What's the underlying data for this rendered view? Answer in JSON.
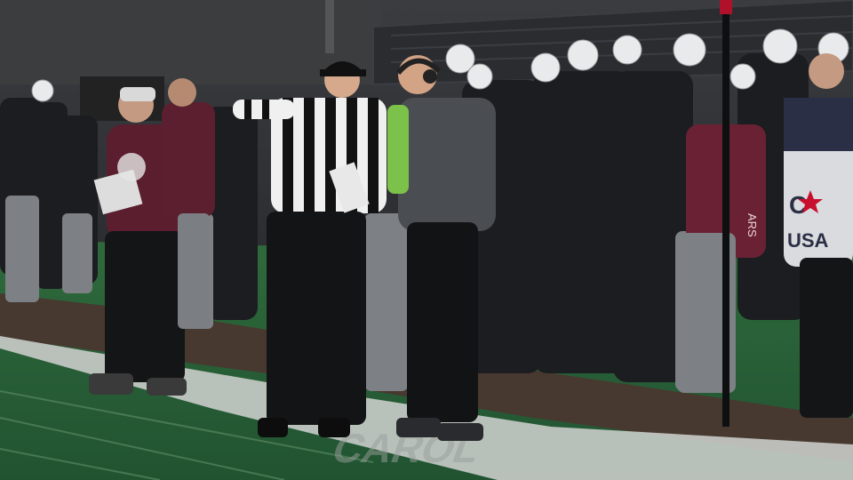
{
  "scene": {
    "description_colors": {
      "turf": "#2f6b3a",
      "turf_dark": "#234f2c",
      "sideline_dirt": "#4a3a30",
      "maroon": "#5e1f2f",
      "gray": "#6f7276",
      "black": "#141517"
    }
  },
  "texts": {
    "jacket_logo": "C",
    "jacket_logo_sub": "USA",
    "hoodie_text": "ARS",
    "field_paint": "CAROL"
  }
}
